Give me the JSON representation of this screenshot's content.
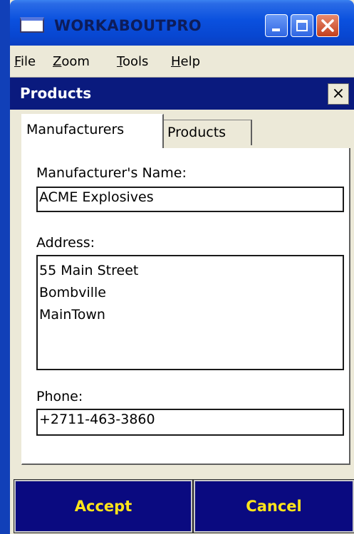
{
  "window": {
    "title": "WORKABOUTPRO",
    "app_icon": "window-icon",
    "controls": [
      "minimize-icon",
      "maximize-icon",
      "close-icon"
    ]
  },
  "menu": {
    "items": [
      {
        "access_key": "F",
        "rest": "ile"
      },
      {
        "access_key": "Z",
        "rest": "oom"
      },
      {
        "access_key": "T",
        "rest": "ools"
      },
      {
        "access_key": "H",
        "rest": "elp"
      }
    ]
  },
  "panel": {
    "title": "Products",
    "close_glyph": "×"
  },
  "tabs": [
    {
      "label": "Manufacturers",
      "active": true
    },
    {
      "label": "Products",
      "active": false
    }
  ],
  "form": {
    "name_label": "Manufacturer's Name:",
    "name_value": "ACME Explosives",
    "address_label": "Address:",
    "address_value": "55 Main Street\nBombville\nMainTown",
    "phone_label": "Phone:",
    "phone_value": "+2711-463-3860"
  },
  "buttons": {
    "accept": "Accept",
    "cancel": "Cancel"
  },
  "colors": {
    "header_bg": "#0a1a7e",
    "button_bg": "#0a0a80",
    "button_text": "#ffe51a"
  }
}
